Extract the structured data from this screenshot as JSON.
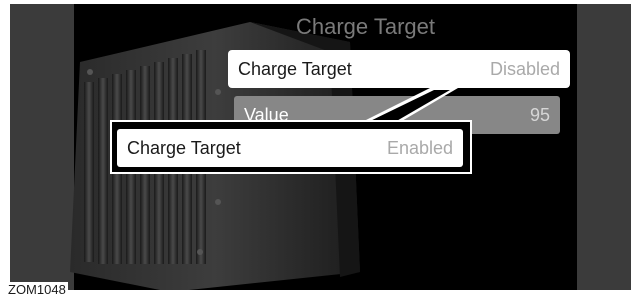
{
  "screen": {
    "title": "Charge Target"
  },
  "menu": {
    "charge_target_row": {
      "label": "Charge Target",
      "value": "Disabled"
    },
    "value_row": {
      "label": "Value",
      "value": "95"
    }
  },
  "callout": {
    "label": "Charge Target",
    "value": "Enabled"
  },
  "figure_id": "ZOM1048"
}
